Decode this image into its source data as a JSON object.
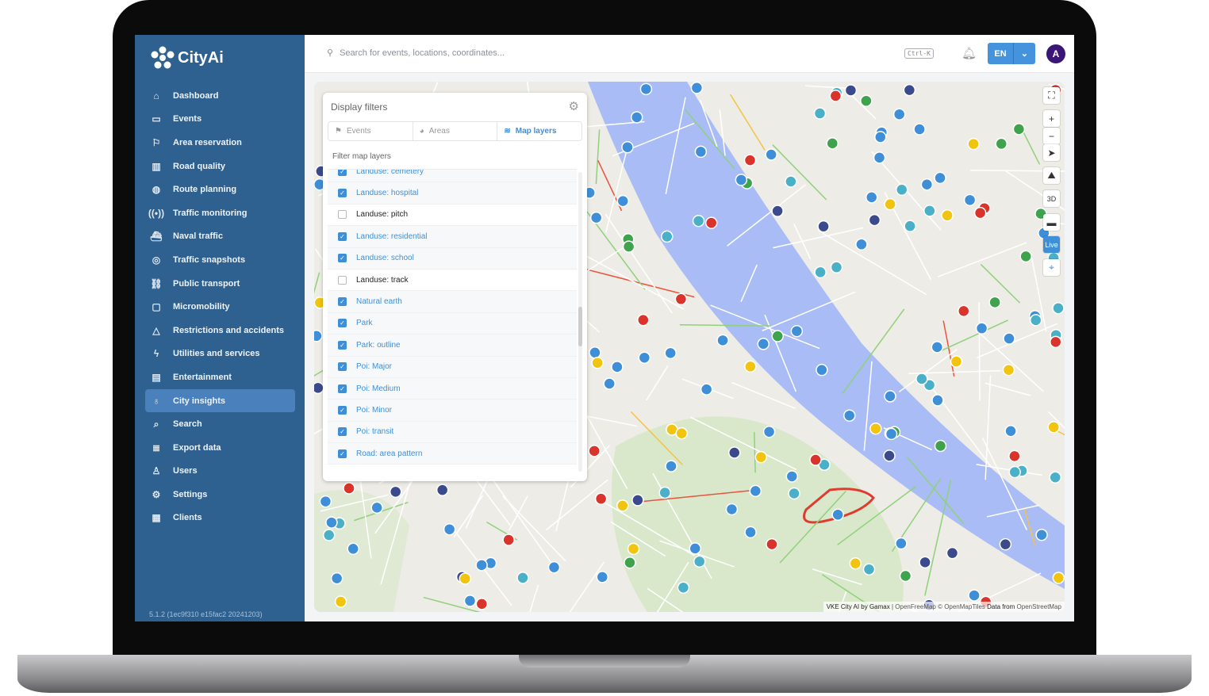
{
  "app": {
    "name": "CityAi",
    "version": "5.1.2 (1ec9f310 e15fac2 20241203)"
  },
  "sidebar": {
    "items": [
      {
        "label": "Dashboard",
        "icon": "home-icon",
        "glyph": "⌂"
      },
      {
        "label": "Events",
        "icon": "calendar-icon",
        "glyph": "▭"
      },
      {
        "label": "Area reservation",
        "icon": "flag-icon",
        "glyph": "⚐"
      },
      {
        "label": "Road quality",
        "icon": "chart-icon",
        "glyph": "▥"
      },
      {
        "label": "Route planning",
        "icon": "globe-icon",
        "glyph": "◍"
      },
      {
        "label": "Traffic monitoring",
        "icon": "signal-icon",
        "glyph": "((•))"
      },
      {
        "label": "Naval traffic",
        "icon": "ship-icon",
        "glyph": "⛴"
      },
      {
        "label": "Traffic snapshots",
        "icon": "camera-icon",
        "glyph": "◎"
      },
      {
        "label": "Public transport",
        "icon": "transport-icon",
        "glyph": "⛓"
      },
      {
        "label": "Micromobility",
        "icon": "micromobility-icon",
        "glyph": "▢"
      },
      {
        "label": "Restrictions and accidents",
        "icon": "warning-icon",
        "glyph": "△"
      },
      {
        "label": "Utilities and services",
        "icon": "bolt-icon",
        "glyph": "ϟ"
      },
      {
        "label": "Entertainment",
        "icon": "film-icon",
        "glyph": "▤"
      },
      {
        "label": "City insights",
        "icon": "lightbulb-icon",
        "glyph": "♁",
        "active": true
      },
      {
        "label": "Search",
        "icon": "search-icon",
        "glyph": "⌕"
      },
      {
        "label": "Export data",
        "icon": "database-icon",
        "glyph": "≣"
      },
      {
        "label": "Users",
        "icon": "user-icon",
        "glyph": "♙"
      },
      {
        "label": "Settings",
        "icon": "gear-icon",
        "glyph": "⚙"
      },
      {
        "label": "Clients",
        "icon": "building-icon",
        "glyph": "▦"
      }
    ]
  },
  "header": {
    "search_placeholder": "Search for events, locations, coordinates...",
    "shortcut": "Ctrl-K",
    "language": "EN",
    "avatar": "A"
  },
  "filters": {
    "title": "Display filters",
    "tabs": [
      {
        "label": "Events"
      },
      {
        "label": "Areas"
      },
      {
        "label": "Map layers",
        "active": true
      }
    ],
    "subtitle": "Filter map layers",
    "layers": [
      {
        "label": "Landuse: cemetery",
        "checked": true
      },
      {
        "label": "Landuse: hospital",
        "checked": true
      },
      {
        "label": "Landuse: pitch",
        "checked": false
      },
      {
        "label": "Landuse: residential",
        "checked": true
      },
      {
        "label": "Landuse: school",
        "checked": true
      },
      {
        "label": "Landuse: track",
        "checked": false
      },
      {
        "label": "Natural earth",
        "checked": true
      },
      {
        "label": "Park",
        "checked": true
      },
      {
        "label": "Park: outline",
        "checked": true
      },
      {
        "label": "Poi: Major",
        "checked": true
      },
      {
        "label": "Poi: Medium",
        "checked": true
      },
      {
        "label": "Poi: Minor",
        "checked": true
      },
      {
        "label": "Poi: transit",
        "checked": true
      },
      {
        "label": "Road: area pattern",
        "checked": true
      }
    ]
  },
  "map_controls": {
    "three_d": "3D",
    "live": "Live"
  },
  "attribution": {
    "owner": "VKE City AI by Gamax",
    "sep": " | ",
    "tiles": "OpenFreeMap © OpenMapTiles",
    "data_from": "Data from",
    "osm": "OpenStreetMap"
  },
  "colors": {
    "sidebar": "#2e6190",
    "accent": "#3f8fd8",
    "river": "#a9bcf5",
    "park": "#d7e8c7"
  }
}
